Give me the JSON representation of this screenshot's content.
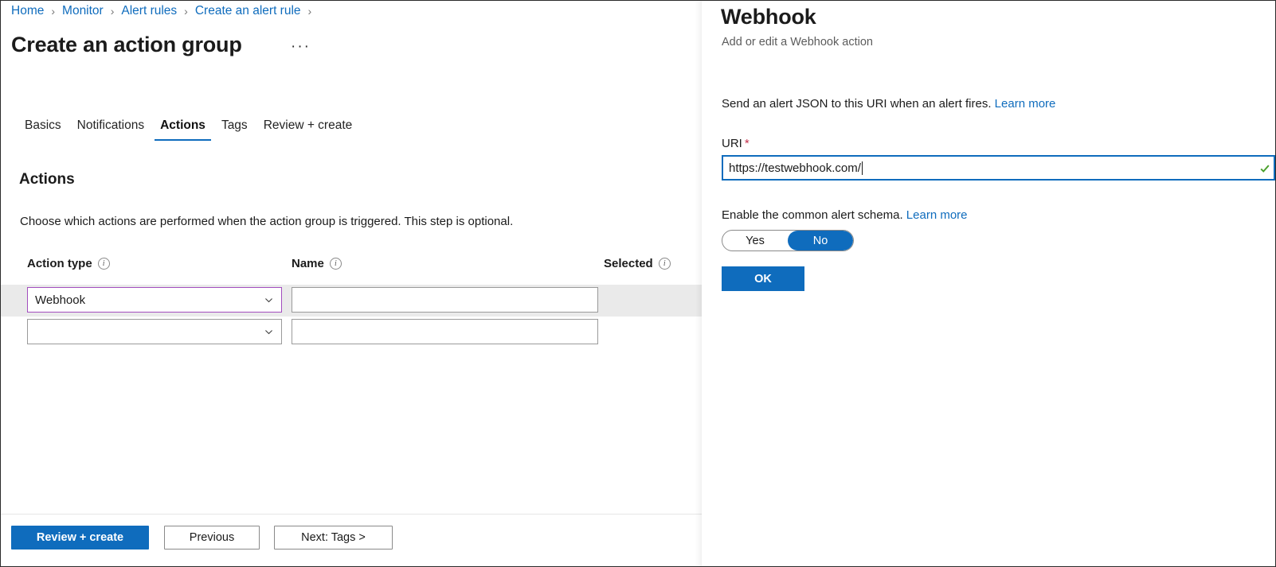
{
  "breadcrumb": {
    "separator": "›",
    "items": [
      {
        "label": "Home"
      },
      {
        "label": "Monitor"
      },
      {
        "label": "Alert rules"
      },
      {
        "label": "Create an alert rule"
      }
    ]
  },
  "page": {
    "title": "Create an action group",
    "ellipsis": "···"
  },
  "tabs": [
    {
      "label": "Basics",
      "active": false
    },
    {
      "label": "Notifications",
      "active": false
    },
    {
      "label": "Actions",
      "active": true
    },
    {
      "label": "Tags",
      "active": false
    },
    {
      "label": "Review + create",
      "active": false
    }
  ],
  "section": {
    "heading": "Actions",
    "description": "Choose which actions are performed when the action group is triggered. This step is optional."
  },
  "table": {
    "columns": [
      {
        "label": "Action type",
        "info_icon": "info-icon",
        "info_glyph": "i"
      },
      {
        "label": "Name",
        "info_icon": "info-icon",
        "info_glyph": "i"
      },
      {
        "label": "Selected",
        "info_icon": "info-icon",
        "info_glyph": "i"
      }
    ],
    "rows": [
      {
        "action_type": "Webhook",
        "action_type_placeholder": "",
        "name_value": "",
        "name_placeholder": "",
        "selected": "",
        "highlighted": true,
        "focused": true
      },
      {
        "action_type": "",
        "action_type_placeholder": "",
        "name_value": "",
        "name_placeholder": "",
        "selected": "",
        "highlighted": false,
        "focused": false
      }
    ]
  },
  "footer": {
    "review_create": "Review + create",
    "previous": "Previous",
    "next": "Next: Tags >"
  },
  "panel": {
    "title": "Webhook",
    "subtitle": "Add or edit a Webhook action",
    "description": "Send an alert JSON to this URI when an alert fires.",
    "description_link": "Learn more",
    "uri_label": "URI",
    "uri_required_marker": "*",
    "uri_value": "https://testwebhook.com/",
    "uri_placeholder": "",
    "uri_valid_icon": "checkmark-icon",
    "schema_label": "Enable the common alert schema.",
    "schema_link": "Learn more",
    "toggle": {
      "options": [
        {
          "label": "Yes",
          "selected": false
        },
        {
          "label": "No",
          "selected": true
        }
      ]
    },
    "ok_button": "OK"
  },
  "colors": {
    "accent_blue": "#0f6cbd",
    "link_blue": "#0f6cbd",
    "focus_purple": "#a24dbe",
    "required_red": "#c4314b",
    "valid_green": "#4aa02c",
    "row_highlight": "#eaeaea"
  }
}
